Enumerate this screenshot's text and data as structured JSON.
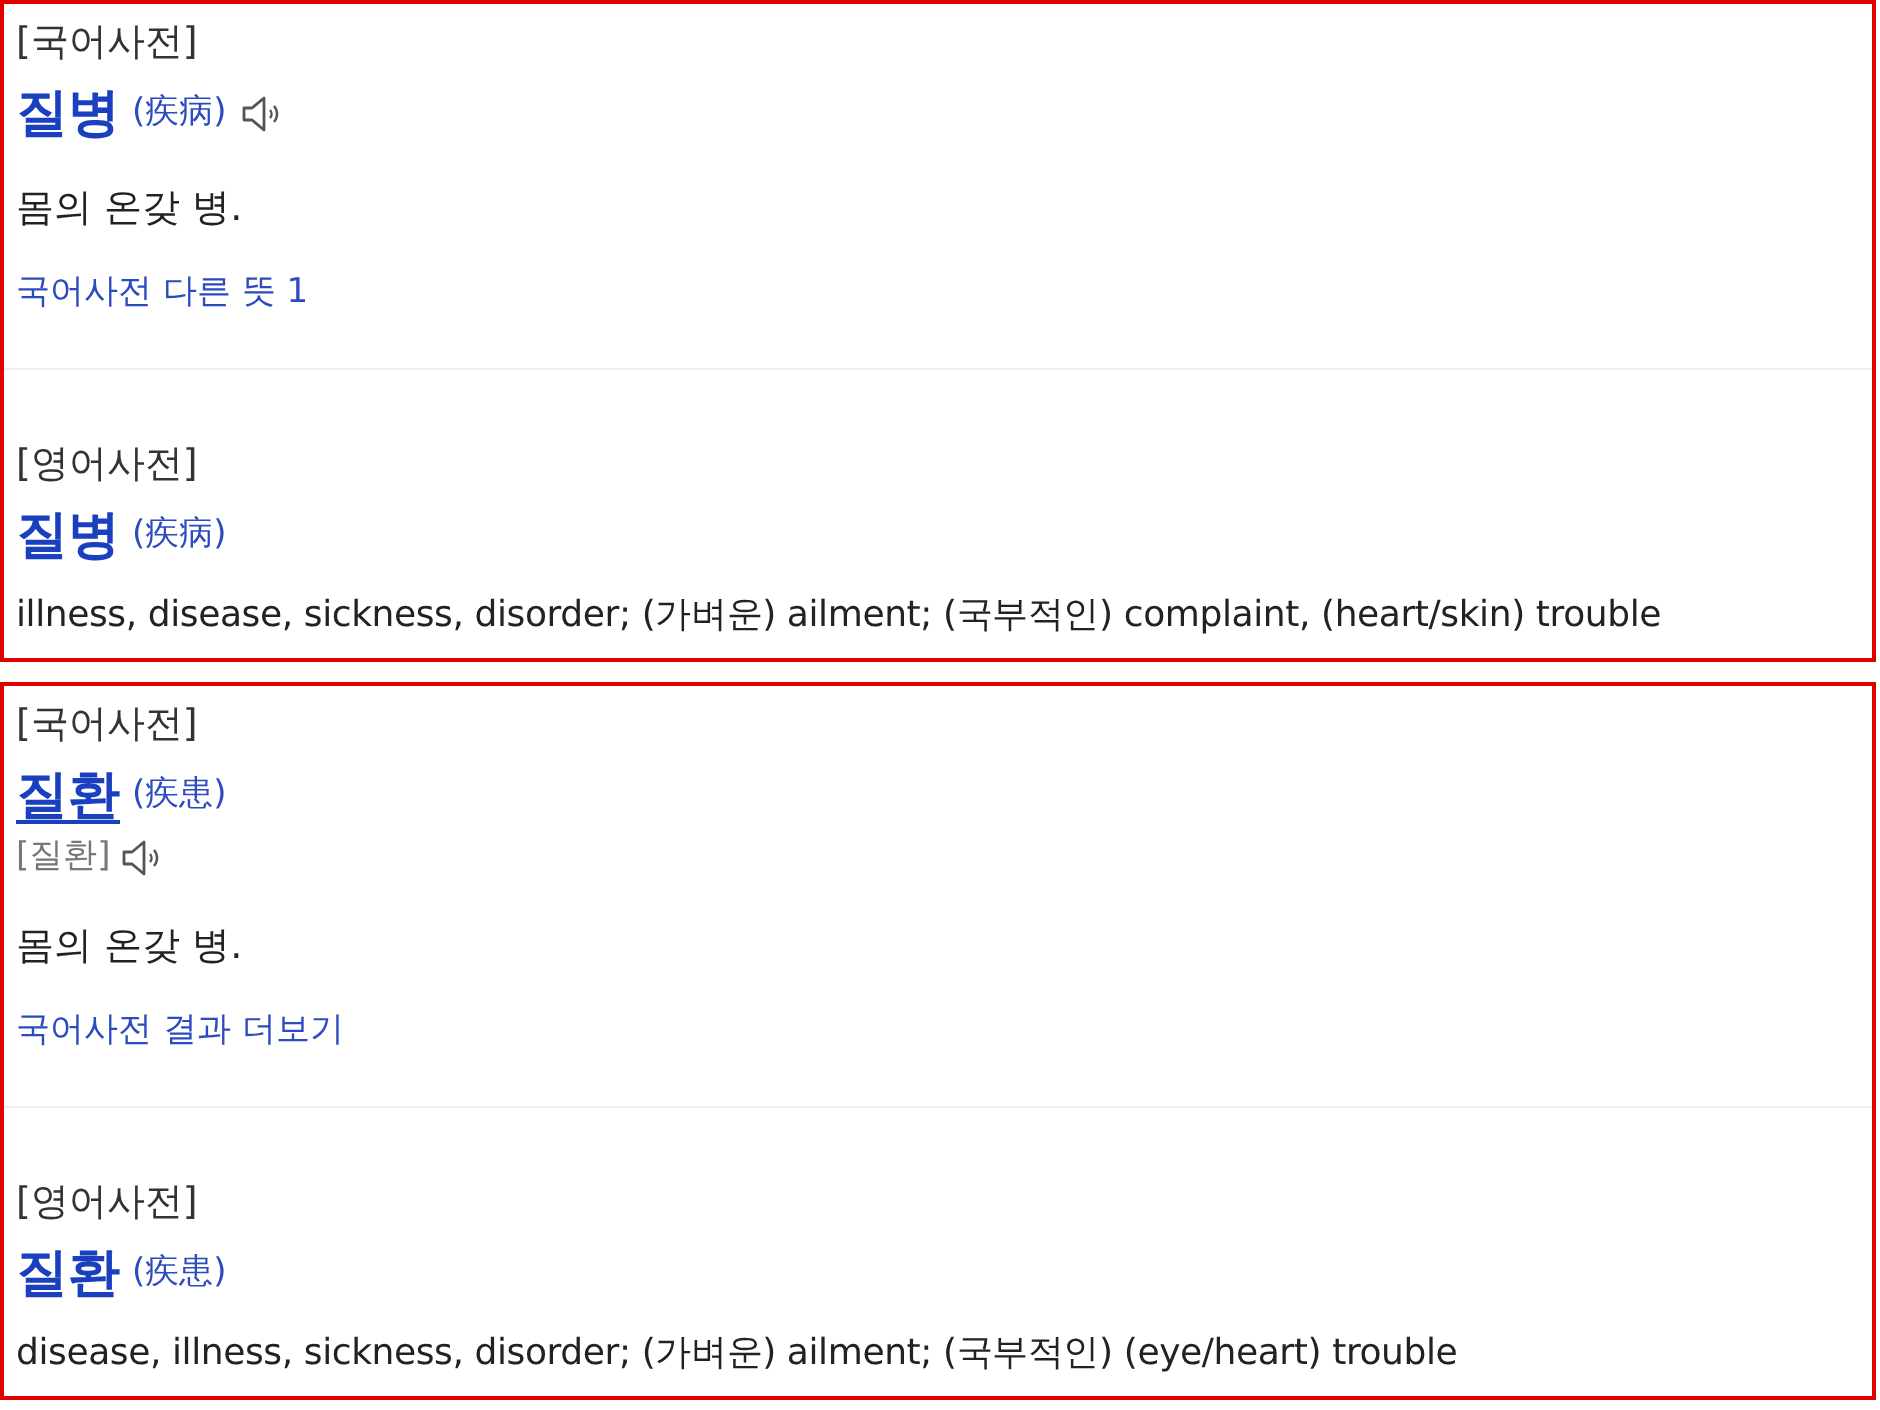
{
  "results": [
    {
      "sections": [
        {
          "kind": "korean",
          "source": "[국어사전]",
          "headword": "질병",
          "underlined": false,
          "hanja": "(疾病)",
          "audio": true,
          "definition": "몸의 온갖 병.",
          "link": "국어사전 다른 뜻 1"
        },
        {
          "kind": "english",
          "source": "[영어사전]",
          "headword": "질병",
          "underlined": false,
          "hanja": "(疾病)",
          "audio": false,
          "definition": "illness, disease, sickness, disorder; (가벼운) ailment; (국부적인) complaint, (heart/skin) trouble"
        }
      ]
    },
    {
      "sections": [
        {
          "kind": "korean",
          "source": "[국어사전]",
          "headword": "질환",
          "underlined": true,
          "hanja": "(疾患)",
          "pronunciation": "[질환]",
          "audio": true,
          "definition": "몸의 온갖 병.",
          "link": "국어사전 결과 더보기"
        },
        {
          "kind": "english",
          "source": "[영어사전]",
          "headword": "질환",
          "underlined": false,
          "hanja": "(疾患)",
          "audio": false,
          "definition": "disease, illness, sickness, disorder; (가벼운) ailment; (국부적인) (eye/heart) trouble"
        }
      ]
    }
  ]
}
